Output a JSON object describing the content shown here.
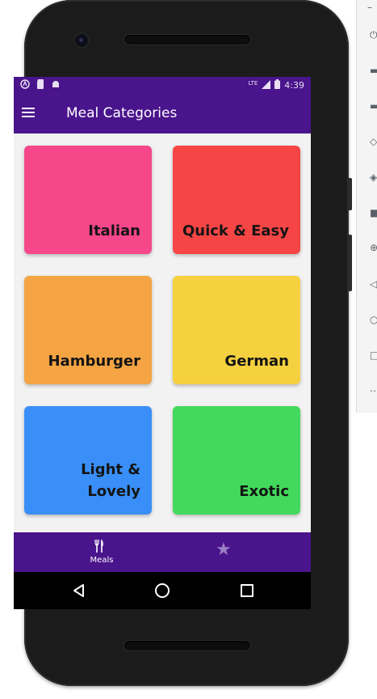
{
  "status_bar": {
    "time": "4:39",
    "network_label": "LTE",
    "left_icons": [
      "app-icon",
      "sd-card-icon",
      "android-icon"
    ],
    "right_icons": [
      "signal-icon",
      "battery-icon"
    ]
  },
  "app_bar": {
    "title": "Meal Categories",
    "menu_icon": "hamburger-menu-icon"
  },
  "categories": [
    {
      "label": "Italian",
      "color": "#f5478a"
    },
    {
      "label": "Quick & Easy",
      "color": "#f54545"
    },
    {
      "label": "Hamburger",
      "color": "#f4a443"
    },
    {
      "label": "German",
      "color": "#f5d13f"
    },
    {
      "label": "Light &\nLovely",
      "color": "#398ff7"
    },
    {
      "label": "Exotic",
      "color": "#43d95c"
    }
  ],
  "bottom_nav": {
    "items": [
      {
        "label": "Meals",
        "icon": "fork-knife-icon",
        "selected": true
      },
      {
        "label": "",
        "icon": "star-icon",
        "selected": false
      }
    ]
  },
  "system_nav": {
    "icons": [
      "back-icon",
      "home-icon",
      "recents-icon"
    ]
  },
  "emulator_toolbar": {
    "icons": [
      "minimize-icon",
      "power-icon",
      "volume-up-icon",
      "volume-down-icon",
      "rotate-left-icon",
      "rotate-right-icon",
      "screenshot-icon",
      "zoom-icon",
      "back-icon",
      "home-icon",
      "overview-icon",
      "more-icon"
    ]
  },
  "colors": {
    "primary": "#4a148c",
    "background": "#f2f2f2"
  }
}
